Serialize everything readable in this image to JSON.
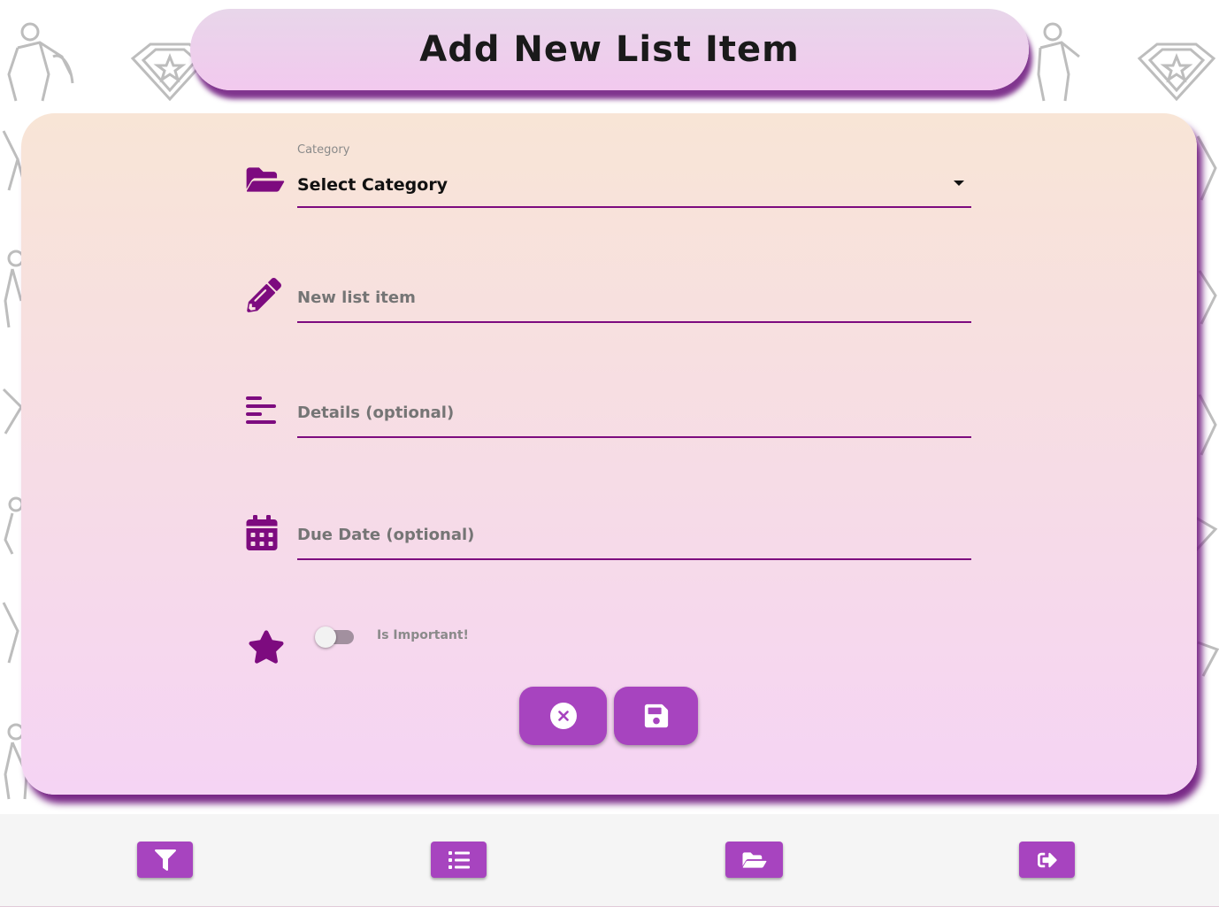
{
  "header": {
    "title": "Add New List Item"
  },
  "form": {
    "category": {
      "label": "Category",
      "value": "Select Category",
      "icon": "folder-open-icon"
    },
    "item": {
      "placeholder": "New list item",
      "icon": "pencil-icon"
    },
    "details": {
      "placeholder": "Details (optional)",
      "icon": "align-left-icon"
    },
    "due_date": {
      "placeholder": "Due Date (optional)",
      "icon": "calendar-icon"
    },
    "important": {
      "label": "Is Important!",
      "checked": false,
      "icon": "star-icon"
    }
  },
  "actions": [
    {
      "name": "cancel",
      "icon": "close-circle-icon"
    },
    {
      "name": "save",
      "icon": "floppy-disk-icon"
    }
  ],
  "nav": [
    {
      "name": "filter",
      "icon": "filter-icon"
    },
    {
      "name": "list",
      "icon": "list-icon"
    },
    {
      "name": "categories",
      "icon": "folder-open-icon"
    },
    {
      "name": "logout",
      "icon": "sign-out-icon"
    }
  ],
  "colors": {
    "accent": "#7d0b7f",
    "button": "#a744bf",
    "header_gradient_top": "#e8d6ea",
    "header_gradient_bottom": "#f2c9ee",
    "card_gradient_top": "#f8e5d6",
    "card_gradient_bottom": "#f5d4f4"
  }
}
